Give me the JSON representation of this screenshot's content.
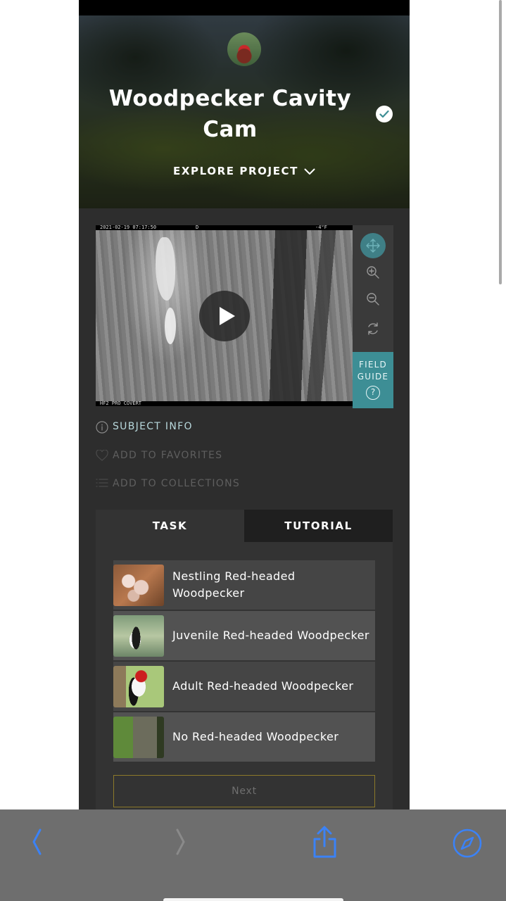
{
  "hero": {
    "title": "Woodpecker Cavity Cam",
    "explore_label": "EXPLORE PROJECT"
  },
  "media": {
    "timestamp": "2021-02-19 07:17:50",
    "mode": "D",
    "temperature": "-4°F",
    "camera_model": "HF2 PRO COVERT"
  },
  "viewer_controls": {
    "field_guide_label": "FIELD GUIDE",
    "field_guide_help": "?"
  },
  "meta": {
    "subject_info": "SUBJECT INFO",
    "add_to_favorites": "ADD TO FAVORITES",
    "add_to_collections": "ADD TO COLLECTIONS"
  },
  "tabs": {
    "task": "TASK",
    "tutorial": "TUTORIAL"
  },
  "answers": [
    {
      "label": "Nestling Red-headed Woodpecker"
    },
    {
      "label": "Juvenile Red-headed Woodpecker"
    },
    {
      "label": "Adult Red-headed Woodpecker"
    },
    {
      "label": "No Red-headed Woodpecker"
    }
  ],
  "next_label": "Next",
  "colors": {
    "accent_teal": "#3d8e95",
    "panel_bg": "#2d2d2d",
    "toolbar_blue": "#3b82f6"
  },
  "icons": {
    "verified": "check-circle-icon",
    "explore": "chevron-down-icon",
    "play": "play-icon",
    "move": "move-arrows-icon",
    "zoom_in": "zoom-in-icon",
    "zoom_out": "zoom-out-icon",
    "rotate": "rotate-icon",
    "info": "info-icon",
    "favorite": "heart-icon",
    "collections": "list-icon",
    "back": "chevron-left-icon",
    "forward": "chevron-right-icon",
    "share": "share-icon",
    "compass": "compass-icon"
  }
}
